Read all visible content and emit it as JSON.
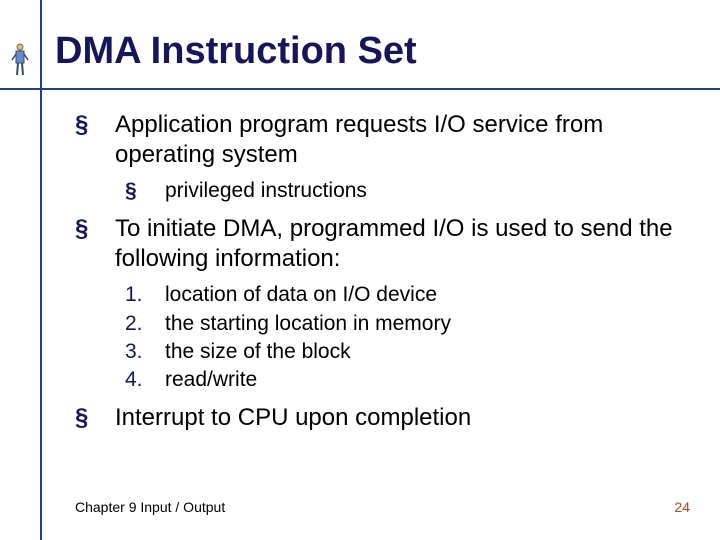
{
  "title": "DMA Instruction Set",
  "bullets": {
    "b1_a": "Application program requests I/O service from operating system",
    "b2_a": "privileged instructions",
    "b1_b": "To initiate DMA, programmed I/O is used to send the following information:",
    "num1_label": "1.",
    "num1_text": "location of data on I/O device",
    "num2_label": "2.",
    "num2_text": "the starting location in memory",
    "num3_label": "3.",
    "num3_text": "the size of the block",
    "num4_label": "4.",
    "num4_text": "read/write",
    "b1_c": "Interrupt to CPU upon completion"
  },
  "footer": {
    "left": "Chapter 9 Input / Output",
    "right": "24"
  }
}
